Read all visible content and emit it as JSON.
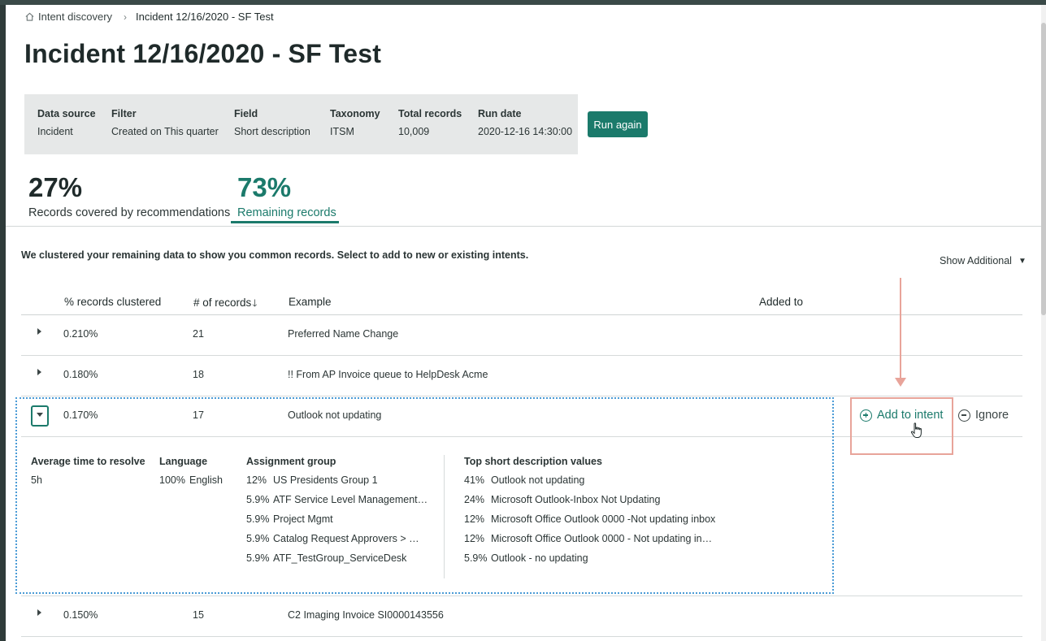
{
  "breadcrumb": {
    "parent": "Intent discovery",
    "current": "Incident 12/16/2020 - SF Test"
  },
  "page_title": "Incident 12/16/2020 - SF Test",
  "info": {
    "data_source": {
      "label": "Data source",
      "value": "Incident"
    },
    "filter": {
      "label": "Filter",
      "value": "Created on This quarter"
    },
    "field": {
      "label": "Field",
      "value": "Short description"
    },
    "taxonomy": {
      "label": "Taxonomy",
      "value": "ITSM"
    },
    "total_records": {
      "label": "Total records",
      "value": "10,009"
    },
    "run_date": {
      "label": "Run date",
      "value": "2020-12-16 14:30:00"
    }
  },
  "run_again_label": "Run again",
  "stats": {
    "covered": {
      "pct": "27%",
      "caption": "Records covered by recommendations"
    },
    "remaining": {
      "pct": "73%",
      "caption": "Remaining records"
    }
  },
  "intro_text": "We clustered your remaining data to show you common records. Select to add to new or existing intents.",
  "show_additional": "Show Additional",
  "table": {
    "headers": {
      "pct": "% records clustered",
      "count": "# of records",
      "example": "Example",
      "added_to": "Added to"
    },
    "rows": [
      {
        "pct": "0.210%",
        "count": "21",
        "example": "Preferred Name Change"
      },
      {
        "pct": "0.180%",
        "count": "18",
        "example": "!! From AP Invoice queue to HelpDesk Acme"
      },
      {
        "pct": "0.170%",
        "count": "17",
        "example": "Outlook not updating"
      },
      {
        "pct": "0.150%",
        "count": "15",
        "example": "C2 Imaging Invoice SI0000143556"
      }
    ]
  },
  "details": {
    "avg_time": {
      "label": "Average time to resolve",
      "value": "5h"
    },
    "language": {
      "label": "Language",
      "pct": "100%",
      "value": "English"
    },
    "assignment_group": {
      "label": "Assignment group",
      "items": [
        {
          "pct": "12%",
          "name": "US Presidents Group 1"
        },
        {
          "pct": "5.9%",
          "name": "ATF Service Level Management…"
        },
        {
          "pct": "5.9%",
          "name": "Project Mgmt"
        },
        {
          "pct": "5.9%",
          "name": "Catalog Request Approvers > …"
        },
        {
          "pct": "5.9%",
          "name": "ATF_TestGroup_ServiceDesk"
        }
      ]
    },
    "top_values": {
      "label": "Top short description values",
      "items": [
        {
          "pct": "41%",
          "name": "Outlook not updating"
        },
        {
          "pct": "24%",
          "name": "Microsoft Outlook-Inbox Not Updating"
        },
        {
          "pct": "12%",
          "name": "Microsoft Office Outlook 0000 -Not updating inbox"
        },
        {
          "pct": "12%",
          "name": "Microsoft Office Outlook 0000 - Not updating in…"
        },
        {
          "pct": "5.9%",
          "name": "Outlook - no updating"
        }
      ]
    }
  },
  "actions": {
    "add_to_intent": "Add to intent",
    "ignore": "Ignore"
  },
  "colors": {
    "accent": "#1b7a6b",
    "annotation": "#e8a49a",
    "focus": "#4a9bd6"
  }
}
